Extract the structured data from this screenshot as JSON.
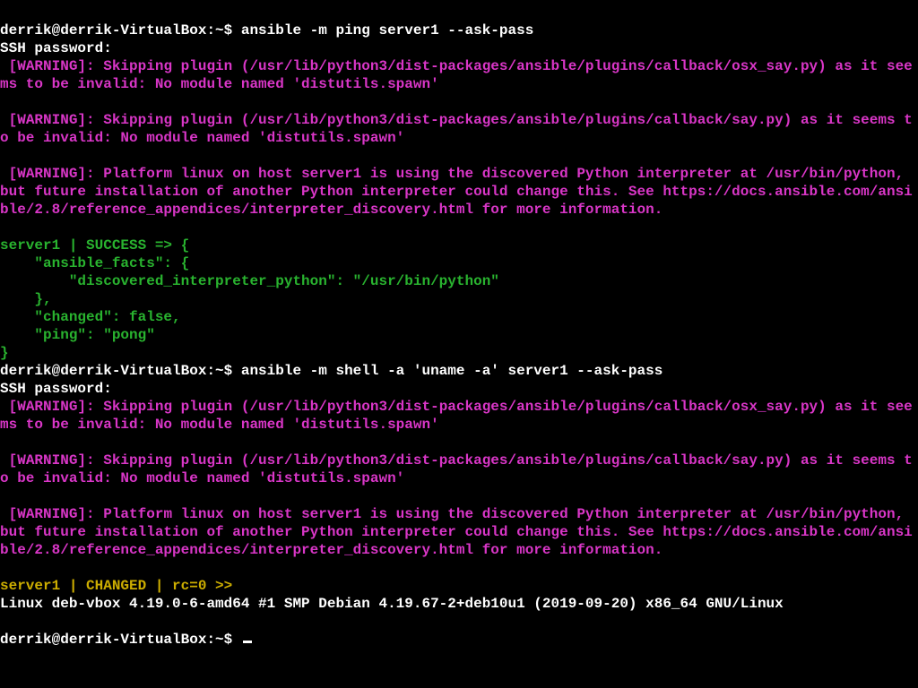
{
  "prompt1": {
    "user_host": "derrik@derrik-VirtualBox:~$ ",
    "command": "ansible -m ping server1 --ask-pass"
  },
  "ssh_prompt": "SSH password:",
  "warn_osx_say": " [WARNING]: Skipping plugin (/usr/lib/python3/dist-packages/ansible/plugins/callback/osx_say.py) as it seems to be invalid: No module named 'distutils.spawn'",
  "warn_say": " [WARNING]: Skipping plugin (/usr/lib/python3/dist-packages/ansible/plugins/callback/say.py) as it seems to be invalid: No module named 'distutils.spawn'",
  "warn_platform": " [WARNING]: Platform linux on host server1 is using the discovered Python interpreter at /usr/bin/python, but future installation of another Python interpreter could change this. See https://docs.ansible.com/ansible/2.8/reference_appendices/interpreter_discovery.html for more information.",
  "success_block": "server1 | SUCCESS => {\n    \"ansible_facts\": {\n        \"discovered_interpreter_python\": \"/usr/bin/python\"\n    },\n    \"changed\": false,\n    \"ping\": \"pong\"\n}",
  "prompt2": {
    "user_host": "derrik@derrik-VirtualBox:~$ ",
    "command": "ansible -m shell -a 'uname -a' server1 --ask-pass"
  },
  "changed_header": "server1 | CHANGED | rc=0 >>",
  "uname_output": "Linux deb-vbox 4.19.0-6-amd64 #1 SMP Debian 4.19.67-2+deb10u1 (2019-09-20) x86_64 GNU/Linux",
  "prompt3": {
    "user_host": "derrik@derrik-VirtualBox:~$ "
  }
}
